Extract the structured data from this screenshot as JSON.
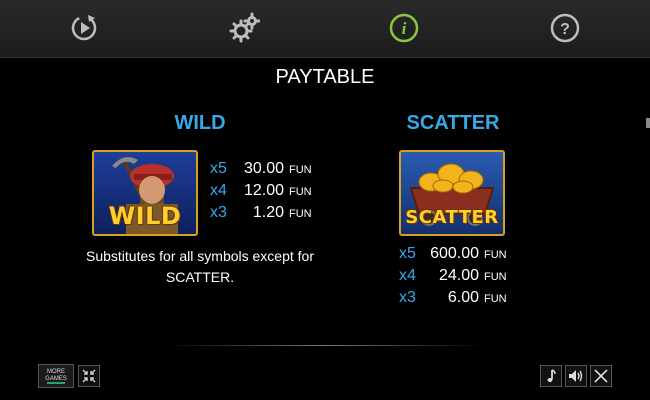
{
  "topbar": {
    "icons": [
      "replay-icon",
      "settings-icon",
      "info-icon",
      "help-icon"
    ],
    "active_color": "#8dc63f",
    "icon_color": "#bdbdbd",
    "info_glyph": "i",
    "help_glyph": "?"
  },
  "title": "PAYTABLE",
  "accent_color": "#38a9e6",
  "wild": {
    "heading": "WILD",
    "symbol_label": "WILD",
    "pays": [
      {
        "mult": "x5",
        "value": "30.00",
        "currency": "FUN"
      },
      {
        "mult": "x4",
        "value": "12.00",
        "currency": "FUN"
      },
      {
        "mult": "x3",
        "value": "1.20",
        "currency": "FUN"
      }
    ],
    "description": "Substitutes for all symbols except for SCATTER."
  },
  "scatter": {
    "heading": "SCATTER",
    "symbol_label": "SCATTER",
    "pays": [
      {
        "mult": "x5",
        "value": "600.00",
        "currency": "FUN"
      },
      {
        "mult": "x4",
        "value": "24.00",
        "currency": "FUN"
      },
      {
        "mult": "x3",
        "value": "6.00",
        "currency": "FUN"
      }
    ]
  },
  "footer": {
    "more_games": "MORE GAMES",
    "icons": [
      "home-icon",
      "shrink-icon",
      "music-icon",
      "sound-icon",
      "close-icon"
    ]
  }
}
